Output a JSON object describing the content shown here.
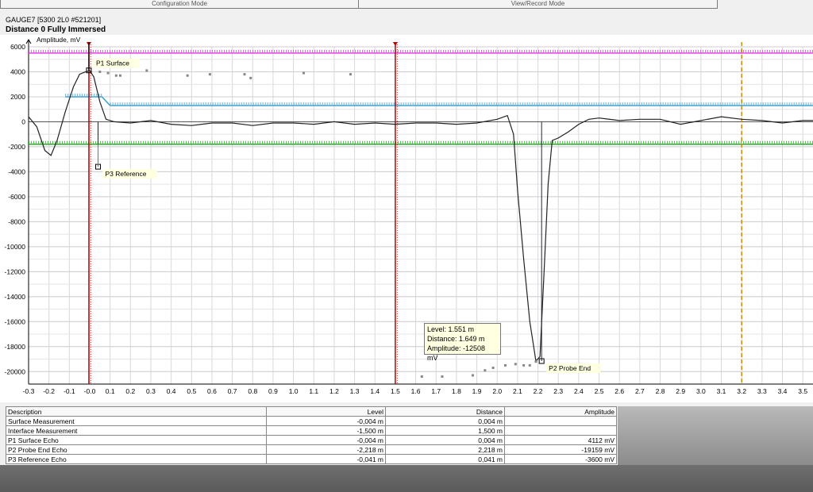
{
  "tabs": [
    "Configuration Mode",
    "View/Record Mode"
  ],
  "header": {
    "gauge": "GAUGE7 [5300 2L0 #521201]",
    "title": "Distance 0 Fully Immersed"
  },
  "tooltip": {
    "level": "Level: 1.551 m",
    "distance": "Distance: 1.649 m",
    "amplitude": "Amplitude: -12508 mV"
  },
  "chart_data": {
    "type": "line",
    "ylabel": "Amplitude, mV",
    "xlim": [
      -0.3,
      3.55
    ],
    "ylim": [
      -21000,
      6000
    ],
    "xticks": [
      "-0.3",
      "-0.2",
      "-0.1",
      "-0.0",
      "0.1",
      "0.2",
      "0.3",
      "0.4",
      "0.5",
      "0.6",
      "0.7",
      "0.8",
      "0.9",
      "1.0",
      "1.1",
      "1.2",
      "1.3",
      "1.4",
      "1.5",
      "1.6",
      "1.7",
      "1.8",
      "1.9",
      "2.0",
      "2.1",
      "2.2",
      "2.3",
      "2.4",
      "2.5",
      "2.6",
      "2.7",
      "2.8",
      "2.9",
      "3.0",
      "3.1",
      "3.2",
      "3.3",
      "3.4",
      "3.5"
    ],
    "yticks": [
      6000,
      4000,
      2000,
      0,
      -2000,
      -4000,
      -6000,
      -8000,
      -10000,
      -12000,
      -14000,
      -16000,
      -18000,
      -20000
    ],
    "series": [
      {
        "x": [
          -0.3,
          -0.26,
          -0.22,
          -0.19,
          -0.16,
          -0.12,
          -0.08,
          -0.05,
          -0.02,
          0.0,
          0.02,
          0.05,
          0.08,
          0.12,
          0.2,
          0.3,
          0.4,
          0.5,
          0.6,
          0.7,
          0.8,
          0.9,
          1.0,
          1.1,
          1.2,
          1.3,
          1.4,
          1.5,
          1.6,
          1.7,
          1.8,
          1.9,
          2.0,
          2.05,
          2.08,
          2.1,
          2.13,
          2.16,
          2.19,
          2.21,
          2.23,
          2.25,
          2.27,
          2.3,
          2.35,
          2.4,
          2.45,
          2.5,
          2.6,
          2.7,
          2.8,
          2.9,
          3.0,
          3.1,
          3.2,
          3.3,
          3.4,
          3.5,
          3.55
        ],
        "y": [
          400,
          -400,
          -2300,
          -2700,
          -1500,
          800,
          2800,
          3800,
          4000,
          4100,
          3600,
          1600,
          200,
          0,
          -100,
          100,
          -200,
          -300,
          -100,
          -100,
          -300,
          -100,
          -100,
          -200,
          0,
          -200,
          -100,
          -200,
          -100,
          -100,
          -200,
          -100,
          200,
          500,
          -1000,
          -5500,
          -11000,
          -16000,
          -19159,
          -18800,
          -12000,
          -5000,
          -1500,
          -1300,
          -800,
          -200,
          200,
          300,
          100,
          200,
          200,
          -200,
          100,
          400,
          200,
          100,
          -100,
          100,
          100
        ]
      },
      {
        "type": "scatter",
        "x": [
          0.05,
          0.09,
          0.13,
          0.15,
          0.28,
          0.48,
          0.59,
          0.76,
          0.79,
          1.05,
          1.28
        ],
        "y": [
          4000,
          3900,
          3700,
          3700,
          4100,
          3700,
          3800,
          3800,
          3500,
          3900,
          3800
        ]
      },
      {
        "type": "scatter",
        "x": [
          1.63,
          1.73,
          1.88,
          1.94,
          1.98,
          2.04,
          2.09,
          2.13,
          2.16,
          2.19
        ],
        "y": [
          -20400,
          -20400,
          -20300,
          -19900,
          -19700,
          -19500,
          -19400,
          -19500,
          -19500,
          -19200
        ]
      }
    ],
    "hlines": [
      {
        "y": 5500,
        "color": "#e040e0"
      },
      {
        "y": 1300,
        "color": "#3aa0d0"
      },
      {
        "y": -1800,
        "color": "#20b020"
      }
    ],
    "vlines": [
      {
        "x": -0.004,
        "color": "#c00000"
      },
      {
        "x": 1.5,
        "color": "#c00000"
      },
      {
        "x": 3.2,
        "color": "#c89000"
      }
    ],
    "markers": [
      {
        "label": "P1 Surface",
        "x": -0.004,
        "y": 4112
      },
      {
        "label": "P2 Probe End",
        "x": 2.218,
        "y": -19159
      },
      {
        "label": "P3 Reference",
        "x": 0.041,
        "y": -3600
      }
    ]
  },
  "table": {
    "headers": [
      "Description",
      "Level",
      "Distance",
      "Amplitude"
    ],
    "rows": [
      [
        "Surface Measurement",
        "-0,004 m",
        "0,004 m",
        ""
      ],
      [
        "Interface Measurement",
        "-1,500 m",
        "1,500 m",
        ""
      ],
      [
        "P1 Surface Echo",
        "-0,004 m",
        "0,004 m",
        "4112 mV"
      ],
      [
        "P2 Probe End Echo",
        "-2,218 m",
        "2,218 m",
        "-19159 mV"
      ],
      [
        "P3 Reference Echo",
        "-0,041 m",
        "0,041 m",
        "-3600 mV"
      ]
    ]
  }
}
